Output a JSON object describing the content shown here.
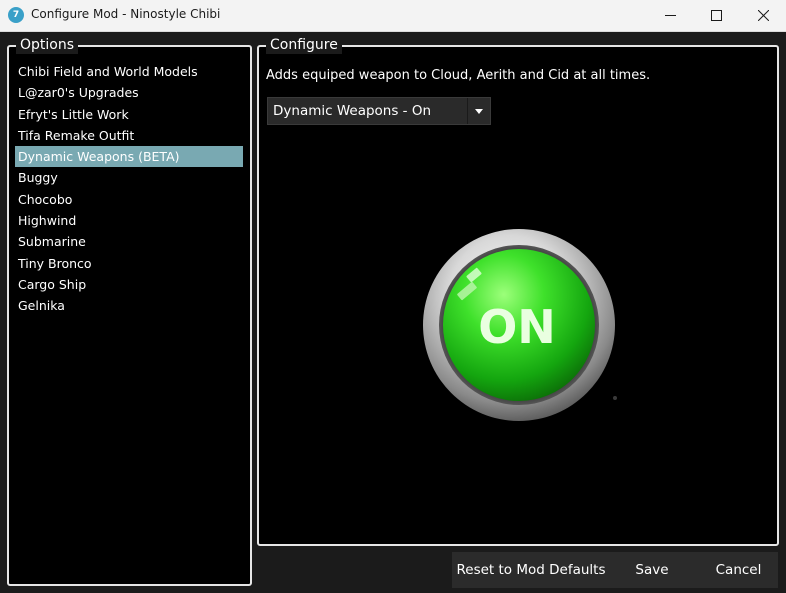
{
  "window": {
    "title": "Configure Mod - Ninostyle Chibi",
    "icon": "app-logo-icon",
    "controls": [
      "minimize-icon",
      "maximize-icon",
      "close-icon"
    ]
  },
  "options": {
    "legend": "Options",
    "items": [
      {
        "label": "Chibi Field and World Models"
      },
      {
        "label": "L@zar0's Upgrades"
      },
      {
        "label": "Efryt's Little Work"
      },
      {
        "label": "Tifa Remake Outfit"
      },
      {
        "label": "Dynamic Weapons (BETA)",
        "selected": true
      },
      {
        "label": "Buggy"
      },
      {
        "label": "Chocobo"
      },
      {
        "label": "Highwind"
      },
      {
        "label": "Submarine"
      },
      {
        "label": "Tiny Bronco"
      },
      {
        "label": "Cargo Ship"
      },
      {
        "label": "Gelnika"
      }
    ],
    "selected_color": "#79a9b2"
  },
  "configure": {
    "legend": "Configure",
    "description": "Adds equiped weapon to Cloud, Aerith and Cid at all times.",
    "dropdown_value": "Dynamic Weapons - On",
    "preview_label": "ON",
    "preview_color": "#22c21a"
  },
  "buttons": {
    "reset": "Reset to Mod Defaults",
    "save": "Save",
    "cancel": "Cancel"
  }
}
